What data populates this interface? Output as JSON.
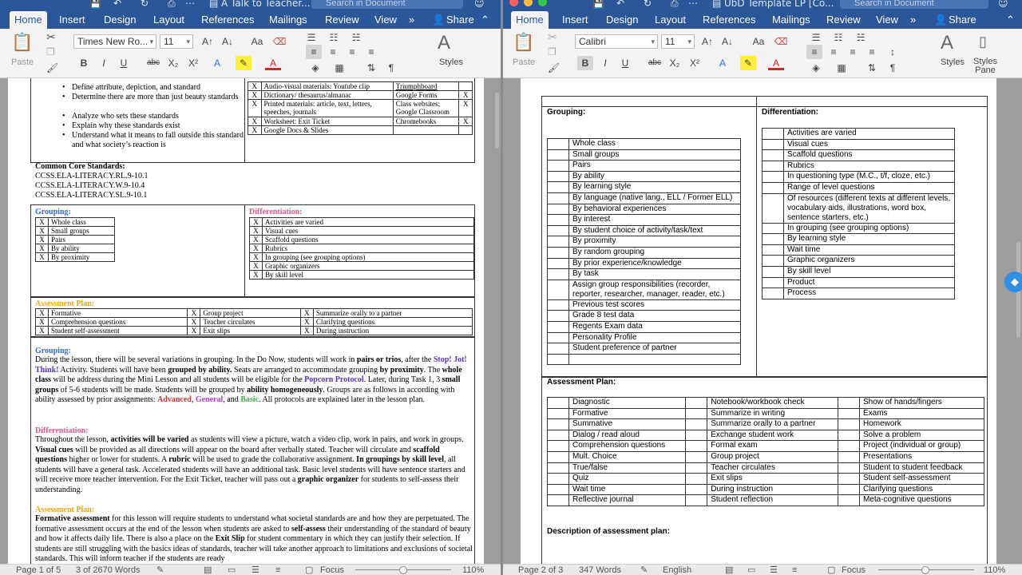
{
  "left_window": {
    "title": "A Talk to Teacher...",
    "search_placeholder": "Search in Document",
    "tabs": [
      "Home",
      "Insert",
      "Design",
      "Layout",
      "References",
      "Mailings",
      "Review",
      "View"
    ],
    "more": "»",
    "share": "Share",
    "ribbon": {
      "paste": "Paste",
      "font": "Times New Ro...",
      "size": "11",
      "styles": "Styles"
    },
    "doc": {
      "bullets": [
        "Define attribute, depiction, and standard",
        "Determine there are more than just beauty standards",
        "Analyze who sets these standards",
        "Explain why these standards exist",
        "Understand what it means to fall outside this standard and what society’s reaction is"
      ],
      "materials": [
        {
          "x": "X",
          "a": "Audio-visual materials:  Youtube clip",
          "b": "Triumphboard",
          "c": ""
        },
        {
          "x": "X",
          "a": "Dictionary/ thesaurus/almanac",
          "b": "Google Forms",
          "c": "X"
        },
        {
          "x": "X",
          "a": "Printed materials:  article, text, letters, speeches, journals",
          "b": "Class websites: Google Classroom",
          "c": "X"
        },
        {
          "x": "X",
          "a": "Worksheet: Exit Ticket",
          "b": "Chromebooks",
          "c": "X"
        },
        {
          "x": "X",
          "a": "Google Docs & Slides",
          "b": "",
          "c": ""
        }
      ],
      "ccss_title": "Common Core Standards:",
      "ccss": [
        "CCSS.ELA-LITERACY.RL.9-10.1",
        "CCSS.ELA-LITERACY.W.9-10.4",
        "CCSS.ELA-LITERACY.SL.9-10.1"
      ],
      "grouping_title": "Grouping:",
      "grouping": [
        {
          "x": "X",
          "t": "Whole class"
        },
        {
          "x": "X",
          "t": "Small groups"
        },
        {
          "x": "X",
          "t": "Pairs"
        },
        {
          "x": "X",
          "t": "By ability"
        },
        {
          "x": "X",
          "t": "By proximity"
        }
      ],
      "diff_title": "Differentiation:",
      "diff": [
        {
          "x": "X",
          "t": "Activities are varied"
        },
        {
          "x": "X",
          "t": "Visual cues"
        },
        {
          "x": "X",
          "t": "Scaffold questions"
        },
        {
          "x": "X",
          "t": "Rubrics"
        },
        {
          "x": "X",
          "t": "In grouping (see grouping options)"
        },
        {
          "x": "X",
          "t": "Graphic organizers"
        },
        {
          "x": "X",
          "t": "By skill level"
        }
      ],
      "assess_title": "Assessment Plan:",
      "assess": [
        [
          "X",
          "Formative",
          "X",
          "Group project",
          "X",
          "Summarize orally to a partner"
        ],
        [
          "X",
          "Comprehension questions",
          "X",
          "Teacher circulates",
          "X",
          "Clarifying questions"
        ],
        [
          "X",
          "Student self-assessment",
          "X",
          "Exit slips",
          "X",
          "During instruction"
        ]
      ],
      "p1_head": "Grouping:",
      "p2_head": "Differentiation:",
      "p3_head": "Assessment Plan:"
    },
    "status": {
      "page": "Page 1 of 5",
      "words": "3 of 2670 Words",
      "focus": "Focus",
      "zoom": "110%"
    }
  },
  "right_window": {
    "title": "UbD Template LP [Co...",
    "search_placeholder": "Search in Document",
    "tabs": [
      "Home",
      "Insert",
      "Design",
      "Layout",
      "References",
      "Mailings",
      "Review",
      "View"
    ],
    "more": "»",
    "share": "Share",
    "ribbon": {
      "paste": "Paste",
      "font": "Calibri",
      "size": "11",
      "styles": "Styles",
      "styles_pane": "Styles Pane"
    },
    "doc": {
      "grouping_title": "Grouping:",
      "grouping": [
        "Whole class",
        "Small groups",
        "Pairs",
        "By ability",
        "By learning style",
        "By language (native lang., ELL / Former ELL)",
        "By behavioral experiences",
        "By interest",
        "By student choice of activity/task/text",
        "By proximity",
        "By random grouping",
        "By prior experience/knowledge",
        "By task",
        "Assign group responsibilities (recorder, reporter, researcher, manager, reader, etc.)",
        "Previous test scores",
        "Grade 8 test data",
        "Regents Exam data",
        "Personality Profile",
        "Student preference of partner",
        ""
      ],
      "diff_title": "Differentiation:",
      "diff": [
        "Activities are varied",
        "Visual cues",
        "Scaffold questions",
        "Rubrics",
        "In questioning type (M.C., t/f, cloze, etc.)",
        "Range of level questions",
        "Of resources (different texts at different levels, vocabulary aids, illustrations, word box, sentence starters, etc.)",
        "In grouping (see grouping options)",
        "By learning style",
        "Wait time",
        "Graphic organizers",
        "By skill level",
        "Product",
        "Process"
      ],
      "assess_title": "Assessment Plan:",
      "assess": [
        [
          "Diagnostic",
          "Notebook/workbook check",
          "Show of hands/fingers"
        ],
        [
          "Formative",
          "Summarize in writing",
          "Exams"
        ],
        [
          "Summative",
          "Summarize orally to a partner",
          "Homework"
        ],
        [
          "Dialog / read aloud",
          "Exchange student work",
          "Solve a problem"
        ],
        [
          "Comprehension questions",
          "Formal exam",
          "Project (individual or group)"
        ],
        [
          "Mult. Choice",
          "Group project",
          "Presentations"
        ],
        [
          "True/false",
          "Teacher circulates",
          "Student to student feedback"
        ],
        [
          "Quiz",
          "Exit slips",
          "Student self-assessment"
        ],
        [
          "Wait time",
          "During instruction",
          "Clarifying questions"
        ],
        [
          "Reflective journal",
          "Student reflection",
          "Meta-cognitive questions"
        ]
      ],
      "desc_title": "Description of assessment plan:"
    },
    "status": {
      "page": "Page 2 of 3",
      "words": "347 Words",
      "lang": "English",
      "focus": "Focus",
      "zoom": "110%"
    }
  }
}
